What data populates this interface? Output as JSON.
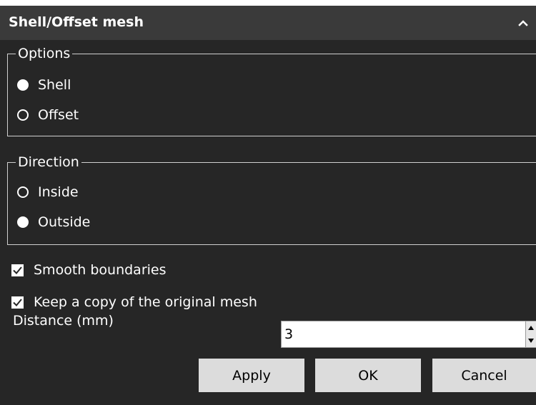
{
  "header": {
    "title": "Shell/Offset mesh"
  },
  "options": {
    "title": "Options",
    "items": [
      {
        "label": "Shell",
        "selected": true
      },
      {
        "label": "Offset",
        "selected": false
      }
    ]
  },
  "direction": {
    "title": "Direction",
    "items": [
      {
        "label": "Inside",
        "selected": false
      },
      {
        "label": "Outside",
        "selected": true
      }
    ]
  },
  "checks": {
    "smooth_boundaries": {
      "label": "Smooth boundaries",
      "checked": true
    },
    "keep_copy": {
      "label": "Keep a copy of the original mesh",
      "checked": true
    }
  },
  "distance": {
    "label": "Distance (mm)",
    "value": "3"
  },
  "buttons": {
    "apply": "Apply",
    "ok": "OK",
    "cancel": "Cancel"
  },
  "colors": {
    "panel_bg": "#262626",
    "header_bg": "#3a3a3a",
    "button_bg": "#dcdcdc",
    "text": "#ffffff"
  },
  "icons": {
    "collapse": "chevron-up-icon",
    "radio_selected": "radio-filled",
    "radio_unselected": "radio-ring",
    "checkbox": "check-icon",
    "spin_up": "spin-up-icon",
    "spin_down": "spin-down-icon"
  }
}
